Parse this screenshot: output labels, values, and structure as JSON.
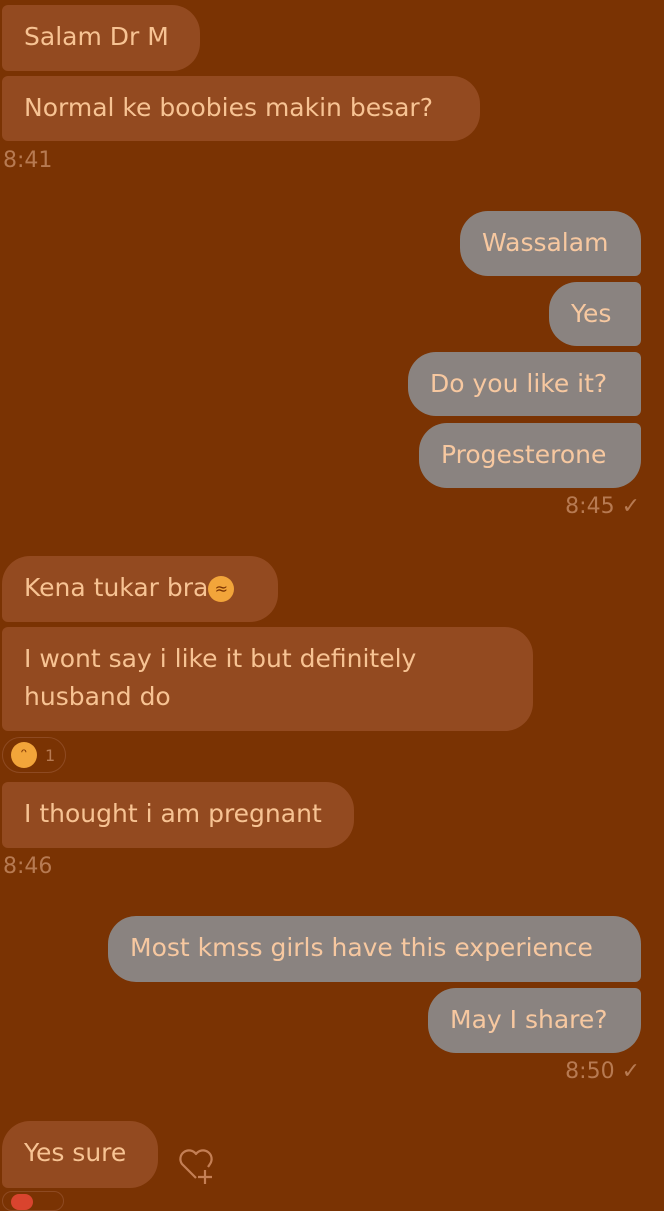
{
  "messages": [
    {
      "dir": "in",
      "text": "Salam Dr M"
    },
    {
      "dir": "in",
      "text": "Normal ke boobies makin besar?"
    },
    {
      "time": "8:41"
    },
    {
      "dir": "out",
      "text": "Wassalam"
    },
    {
      "dir": "out",
      "text": "Yes"
    },
    {
      "dir": "out",
      "text": "Do you like it?"
    },
    {
      "dir": "out",
      "text": "Progesterone"
    },
    {
      "time": "8:45",
      "status": "✓"
    },
    {
      "dir": "in",
      "text": "Kena tukar bra",
      "emoji": "🤣"
    },
    {
      "dir": "in",
      "text": "I wont say i like it but definitely husband do"
    },
    {
      "reaction": "😂",
      "count": "1"
    },
    {
      "dir": "in",
      "text": "I thought i am pregnant"
    },
    {
      "time": "8:46"
    },
    {
      "dir": "out",
      "text": "Most kmss girls have this experience"
    },
    {
      "dir": "out",
      "text": "May I share?"
    },
    {
      "time": "8:50",
      "status": "✓"
    },
    {
      "dir": "in",
      "text": "Yes sure"
    }
  ],
  "icons": {
    "add_reaction": "heart-plus-icon",
    "read_status": "check-icon"
  },
  "colors": {
    "background": "#7a3303",
    "incoming_bubble": "#934a20",
    "outgoing_bubble": "#8a8380",
    "text": "#f7c393"
  }
}
